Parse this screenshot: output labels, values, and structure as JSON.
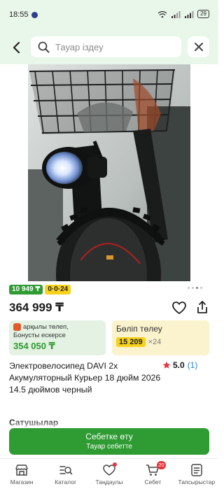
{
  "status_bar": {
    "time": "18:55",
    "battery": "29"
  },
  "search": {
    "placeholder": "Тауар іздеу"
  },
  "product": {
    "badge_bonus": "10 949 ₸",
    "badge_installment": "0·0·24",
    "price": "364 999 ₸",
    "title": "Электровелосипед DAVI 2x Акумуляторный Курьер 18 дюйм 2026 14.5 дюймов черный",
    "rating_value": "5.0",
    "rating_count": "(1)",
    "image_count": 4,
    "image_active_index": 3
  },
  "bonus_card": {
    "line1": "арқылы төлеп,",
    "line2": "Бонусты ескерсе",
    "amount": "354 050 ₸"
  },
  "installment_card": {
    "title": "Бөліп төлеу",
    "amount": "15 209",
    "months": "×24"
  },
  "sellers": {
    "heading": "Сатушылар"
  },
  "cta": {
    "main_label": "Себетке өту",
    "sub_label": "Тауар себетте"
  },
  "bottom_nav": {
    "items": [
      {
        "label": "Магазин",
        "icon": "shop-icon"
      },
      {
        "label": "Каталог",
        "icon": "catalog-icon"
      },
      {
        "label": "Таңдаулы",
        "icon": "heart-icon"
      },
      {
        "label": "Себет",
        "icon": "cart-icon"
      },
      {
        "label": "Тапсырыстар",
        "icon": "orders-icon"
      }
    ],
    "cart_count": "20"
  },
  "colors": {
    "accent_green": "#2e9b33",
    "header_bg": "#e9f6ea",
    "badge_yellow": "#f6d21c",
    "notification_red": "#e8343f",
    "link_blue": "#2a7fd4"
  }
}
